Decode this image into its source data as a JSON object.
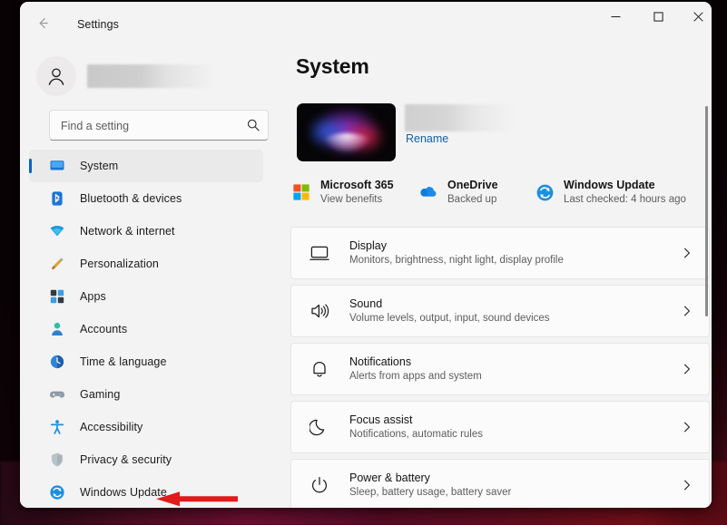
{
  "window": {
    "title": "Settings",
    "back_icon": "back-arrow-icon",
    "controls": {
      "minimize": "minimize-icon",
      "maximize": "maximize-icon",
      "close": "close-icon"
    }
  },
  "sidebar": {
    "account": {
      "avatar_icon": "person-avatar-icon",
      "name": ""
    },
    "search": {
      "placeholder": "Find a setting",
      "value": "",
      "icon": "search-icon"
    },
    "items": [
      {
        "label": "System",
        "icon": "system-monitor-icon",
        "selected": true
      },
      {
        "label": "Bluetooth & devices",
        "icon": "bluetooth-icon",
        "selected": false
      },
      {
        "label": "Network & internet",
        "icon": "network-wifi-icon",
        "selected": false
      },
      {
        "label": "Personalization",
        "icon": "paintbrush-icon",
        "selected": false
      },
      {
        "label": "Apps",
        "icon": "apps-grid-icon",
        "selected": false
      },
      {
        "label": "Accounts",
        "icon": "accounts-person-icon",
        "selected": false
      },
      {
        "label": "Time & language",
        "icon": "clock-globe-icon",
        "selected": false
      },
      {
        "label": "Gaming",
        "icon": "gamepad-icon",
        "selected": false
      },
      {
        "label": "Accessibility",
        "icon": "accessibility-person-icon",
        "selected": false
      },
      {
        "label": "Privacy & security",
        "icon": "shield-icon",
        "selected": false
      },
      {
        "label": "Windows Update",
        "icon": "windows-update-icon",
        "selected": false
      }
    ]
  },
  "main": {
    "title": "System",
    "device": {
      "thumbnail_icon": "windows-bloom-wallpaper",
      "name": "",
      "rename_label": "Rename"
    },
    "status_cards": [
      {
        "title": "Microsoft 365",
        "subtitle": "View benefits",
        "icon": "microsoft-logo-icon"
      },
      {
        "title": "OneDrive",
        "subtitle": "Backed up",
        "icon": "onedrive-cloud-icon"
      },
      {
        "title": "Windows Update",
        "subtitle": "Last checked: 4 hours ago",
        "icon": "windows-update-icon"
      }
    ],
    "settings": [
      {
        "title": "Display",
        "subtitle": "Monitors, brightness, night light, display profile",
        "icon": "display-monitor-icon",
        "chevron": "chevron-right-icon"
      },
      {
        "title": "Sound",
        "subtitle": "Volume levels, output, input, sound devices",
        "icon": "speaker-icon",
        "chevron": "chevron-right-icon"
      },
      {
        "title": "Notifications",
        "subtitle": "Alerts from apps and system",
        "icon": "bell-icon",
        "chevron": "chevron-right-icon"
      },
      {
        "title": "Focus assist",
        "subtitle": "Notifications, automatic rules",
        "icon": "moon-icon",
        "chevron": "chevron-right-icon"
      },
      {
        "title": "Power & battery",
        "subtitle": "Sleep, battery usage, battery saver",
        "icon": "power-icon",
        "chevron": "chevron-right-icon"
      }
    ]
  },
  "annotation": {
    "arrow_icon": "red-arrow-pointing-left",
    "color": "#e01b1b",
    "points_at": "Windows Update"
  },
  "colors": {
    "accent": "#0067c0",
    "window_background": "#f3f3f3",
    "card_background": "#fbfbfb",
    "link": "#0f5fb0",
    "annotation_red": "#e01b1b"
  }
}
